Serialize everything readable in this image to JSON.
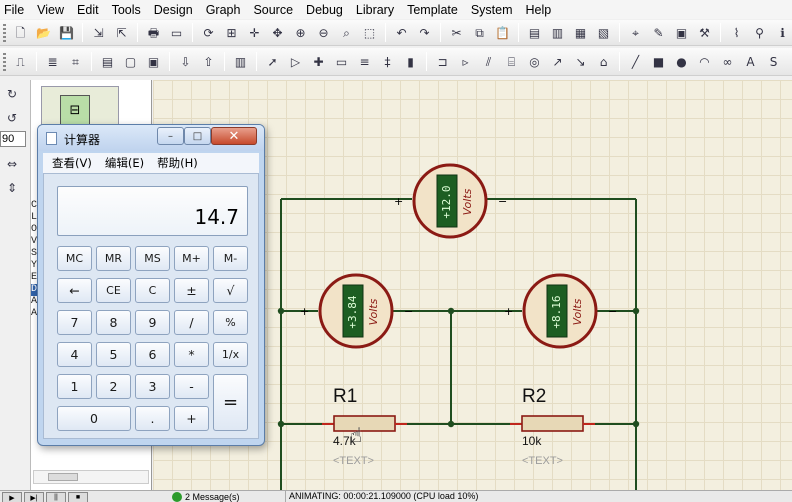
{
  "menu": [
    "File",
    "View",
    "Edit",
    "Tools",
    "Design",
    "Graph",
    "Source",
    "Debug",
    "Library",
    "Template",
    "System",
    "Help"
  ],
  "toolbar1_icons": [
    "new-file",
    "open-folder",
    "save",
    "sep",
    "import",
    "export",
    "sep",
    "print",
    "print-area",
    "sep",
    "refresh",
    "grid",
    "origin",
    "pan",
    "zoom-in",
    "zoom-out",
    "zoom-all",
    "zoom-area",
    "sep",
    "undo",
    "redo",
    "sep",
    "cut",
    "copy",
    "paste",
    "sep",
    "block-copy",
    "block-move",
    "block-rotate",
    "block-delete",
    "sep",
    "pick-device",
    "make-device",
    "packaging",
    "decompose",
    "sep",
    "wire-autorouter",
    "search-tag",
    "property-tool"
  ],
  "toolbar2_icons": [
    "schematic",
    "sep",
    "bill",
    "netlist",
    "sep",
    "design-explorer",
    "new-sheet",
    "remove-sheet",
    "sep",
    "zoom-child",
    "exit-parent",
    "sep",
    "ares",
    "sep",
    "select",
    "component",
    "junction",
    "wire-label",
    "text-script",
    "bus",
    "subcircuit",
    "sep",
    "terminal",
    "pin",
    "graph",
    "tape",
    "generator",
    "probe-v",
    "probe-i",
    "virtual-instrument",
    "sep",
    "line",
    "box",
    "circle",
    "arc",
    "path",
    "text",
    "symbol",
    "marker"
  ],
  "left_tools": [
    "rotate-cw",
    "rotate-ccw",
    "mirror-h",
    "mirror-v"
  ],
  "rotation_value": "90",
  "device_list_letters": [
    "C",
    "L",
    "O",
    "V",
    "S",
    "Y",
    "E",
    "D",
    "A",
    "A"
  ],
  "calculator": {
    "title": "计算器",
    "menu": [
      "查看(V)",
      "编辑(E)",
      "帮助(H)"
    ],
    "display": "14.7",
    "keys": [
      {
        "label": "MC",
        "small": true
      },
      {
        "label": "MR",
        "small": true
      },
      {
        "label": "MS",
        "small": true
      },
      {
        "label": "M+",
        "small": true
      },
      {
        "label": "M-",
        "small": true
      },
      {
        "label": "←"
      },
      {
        "label": "CE",
        "small": true
      },
      {
        "label": "C",
        "small": true
      },
      {
        "label": "±"
      },
      {
        "label": "√"
      },
      {
        "label": "7"
      },
      {
        "label": "8"
      },
      {
        "label": "9"
      },
      {
        "label": "/"
      },
      {
        "label": "%",
        "small": true
      },
      {
        "label": "4"
      },
      {
        "label": "5"
      },
      {
        "label": "6"
      },
      {
        "label": "*"
      },
      {
        "label": "1/x",
        "small": true
      },
      {
        "label": "1"
      },
      {
        "label": "2"
      },
      {
        "label": "3"
      },
      {
        "label": "-"
      },
      {
        "label": "="
      },
      {
        "label": "0"
      },
      {
        "label": "."
      },
      {
        "label": "+"
      }
    ],
    "window_buttons": {
      "minimize": "–",
      "maximize": "□",
      "close": "✕"
    }
  },
  "circuit": {
    "voltmeters": [
      {
        "id": "vm-top",
        "reading": "+12.0",
        "unit": "Volts",
        "plus": "+",
        "minus": "−"
      },
      {
        "id": "vm-left",
        "reading": "+3.84",
        "unit": "Volts",
        "plus": "+",
        "minus": "−"
      },
      {
        "id": "vm-right",
        "reading": "+8.16",
        "unit": "Volts",
        "plus": "+",
        "minus": "−"
      }
    ],
    "resistors": [
      {
        "id": "R1",
        "ref": "R1",
        "value": "4.7k",
        "text": "<TEXT>"
      },
      {
        "id": "R2",
        "ref": "R2",
        "value": "10k",
        "text": "<TEXT>"
      }
    ]
  },
  "status": {
    "sim_controls": [
      "▶",
      "▶|",
      "||",
      "■"
    ],
    "messages": "2 Message(s)",
    "animating": "ANIMATING: 00:00:21.109000 (CPU load 10%)"
  },
  "colors": {
    "wire": "#1f4d1f",
    "meter_ring": "#8b1a14",
    "meter_fill": "#f2e3c8",
    "lcd": "#1d5e22",
    "resistor": "#e7d8b6"
  }
}
